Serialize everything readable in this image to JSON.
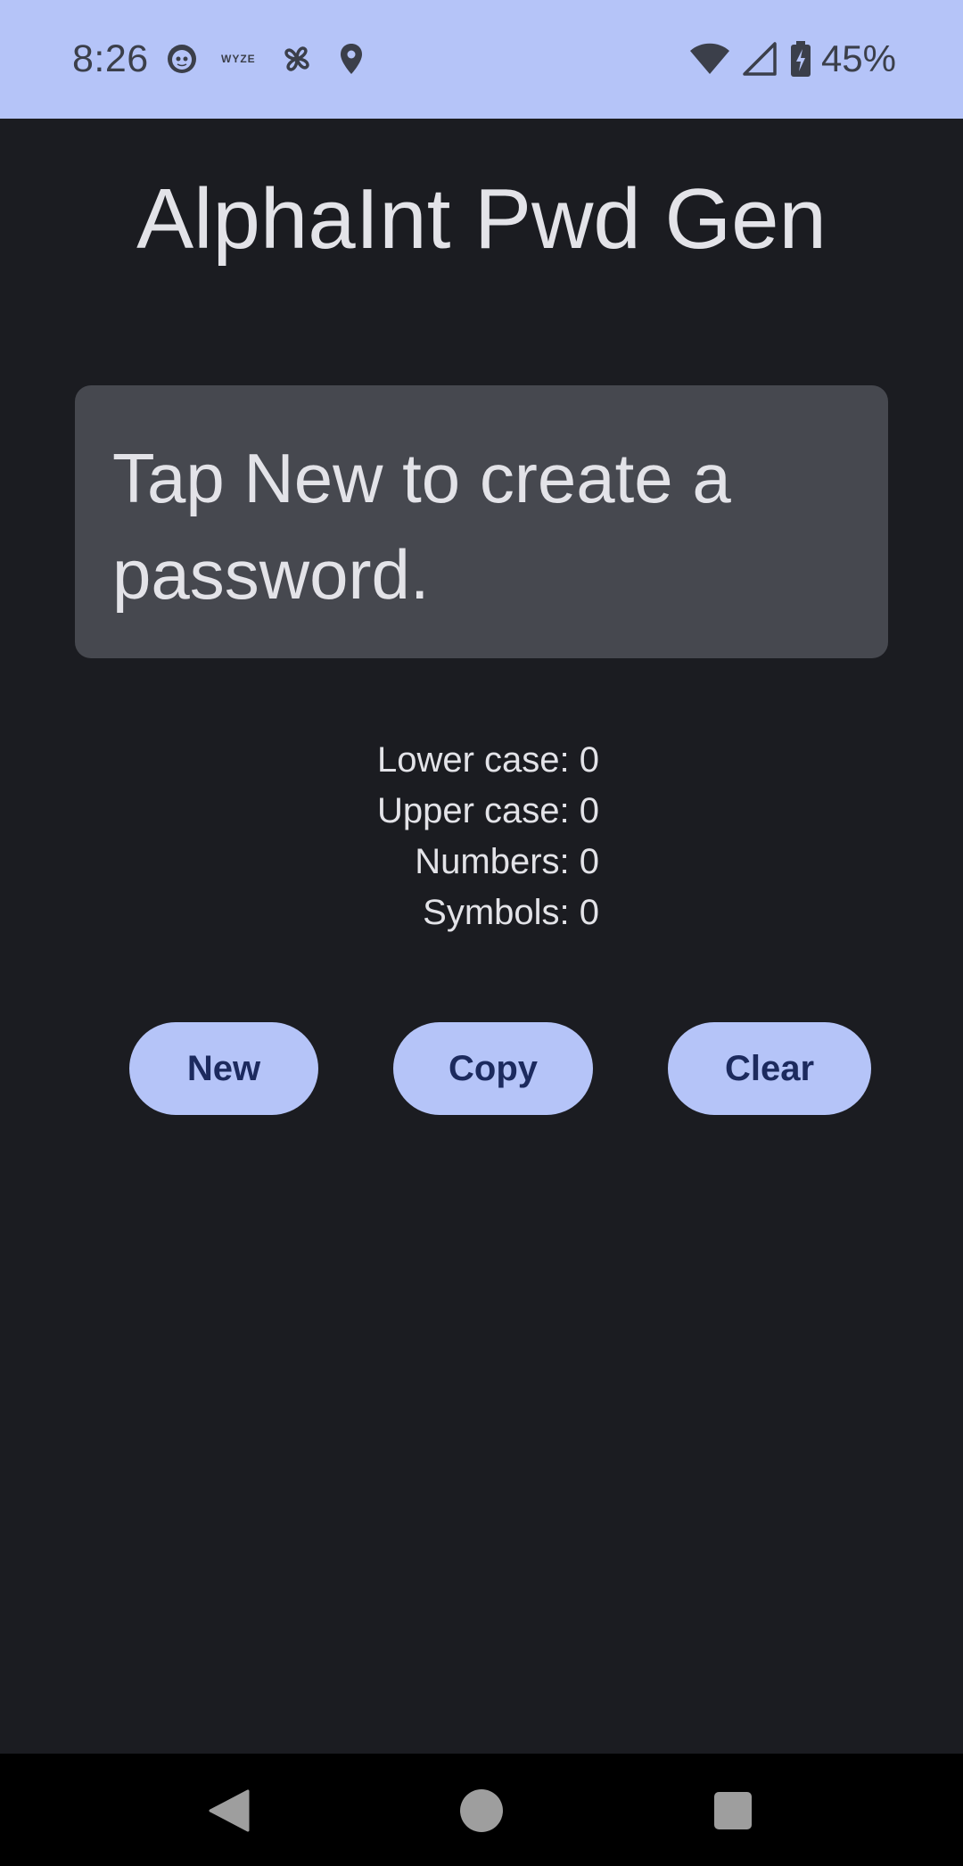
{
  "status_bar": {
    "time": "8:26",
    "left_icons": [
      "face-icon",
      "wyze-icon",
      "fan-icon",
      "location-icon"
    ],
    "wyze_label": "WYZE",
    "right_icons": [
      "wifi-icon",
      "cell-signal-icon",
      "battery-charging-icon"
    ],
    "battery_percent": "45%",
    "background_color": "#b5c4f8"
  },
  "app": {
    "title": "AlphaInt Pwd Gen",
    "password_display": "Tap New to create a password.",
    "stats": {
      "lower": "Lower case: 0",
      "upper": "Upper case: 0",
      "numbers": "Numbers: 0",
      "symbols": "Symbols: 0"
    },
    "buttons": {
      "new": "New",
      "copy": "Copy",
      "clear": "Clear"
    },
    "colors": {
      "background": "#1b1c21",
      "password_box": "#46484f",
      "button": "#b5c4f8",
      "button_text": "#1c2a5e"
    }
  },
  "nav_bar": {
    "icons": [
      "back-icon",
      "home-icon",
      "recents-icon"
    ]
  }
}
